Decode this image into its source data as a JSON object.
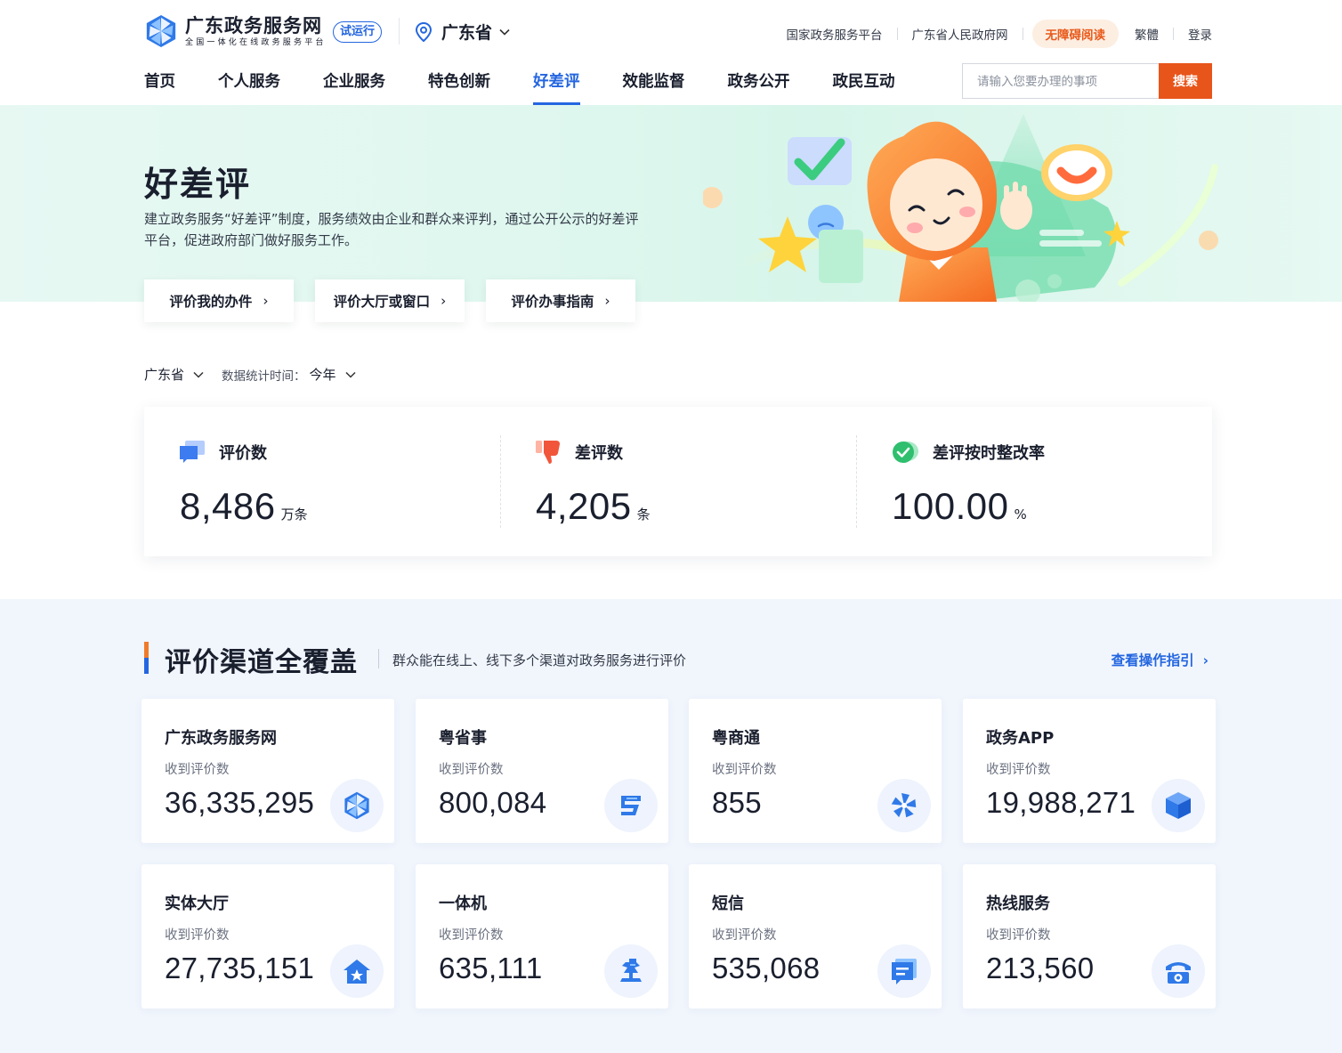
{
  "header": {
    "logo_title": "广东政务服务网",
    "logo_subtitle": "全国一体化在线政务服务平台",
    "trial_badge": "试运行",
    "location": "广东省",
    "top_links": [
      "国家政务服务平台",
      "广东省人民政府网"
    ],
    "accessibility_label": "无障碍阅读",
    "traditional_label": "繁體",
    "login_label": "登录"
  },
  "nav": {
    "items": [
      "首页",
      "个人服务",
      "企业服务",
      "特色创新",
      "好差评",
      "效能监督",
      "政务公开",
      "政民互动"
    ],
    "active": "好差评"
  },
  "search": {
    "placeholder": "请输入您要办理的事项",
    "button_label": "搜索"
  },
  "hero": {
    "title": "好差评",
    "description": "建立政务服务“好差评”制度，服务绩效由企业和群众来评判，通过公开公示的好差评平台，促进政府部门做好服务工作。",
    "buttons": [
      "评价我的办件",
      "评价大厅或窗口",
      "评价办事指南"
    ]
  },
  "filters": {
    "region": "广东省",
    "time_label": "数据统计时间：",
    "time_value": "今年"
  },
  "stats": [
    {
      "label": "评价数",
      "value": "8,486",
      "unit": "万条",
      "icon": "chat-bubble-icon"
    },
    {
      "label": "差评数",
      "value": "4,205",
      "unit": "条",
      "icon": "thumbs-down-icon"
    },
    {
      "label": "差评按时整改率",
      "value": "100.00",
      "unit": "%",
      "icon": "check-circle-icon"
    }
  ],
  "channels": {
    "title": "评价渠道全覆盖",
    "description": "群众能在线上、线下多个渠道对政务服务进行评价",
    "guide_link": "查看操作指引",
    "count_label": "收到评价数",
    "items": [
      {
        "name": "广东政务服务网",
        "count": "36,335,295",
        "icon": "pinwheel-icon"
      },
      {
        "name": "粤省事",
        "count": "800,084",
        "icon": "yue-app-icon"
      },
      {
        "name": "粤商通",
        "count": "855",
        "icon": "propeller-icon"
      },
      {
        "name": "政务APP",
        "count": "19,988,271",
        "icon": "cube-icon"
      },
      {
        "name": "实体大厅",
        "count": "27,735,151",
        "icon": "house-icon"
      },
      {
        "name": "一体机",
        "count": "635,111",
        "icon": "kiosk-icon"
      },
      {
        "name": "短信",
        "count": "535,068",
        "icon": "message-icon"
      },
      {
        "name": "热线服务",
        "count": "213,560",
        "icon": "telephone-icon"
      }
    ]
  },
  "colors": {
    "primary_blue": "#2466e0",
    "accent_orange": "#e8551a",
    "hero_bg": "#def7ee",
    "section_bg": "#f1f6fd"
  }
}
